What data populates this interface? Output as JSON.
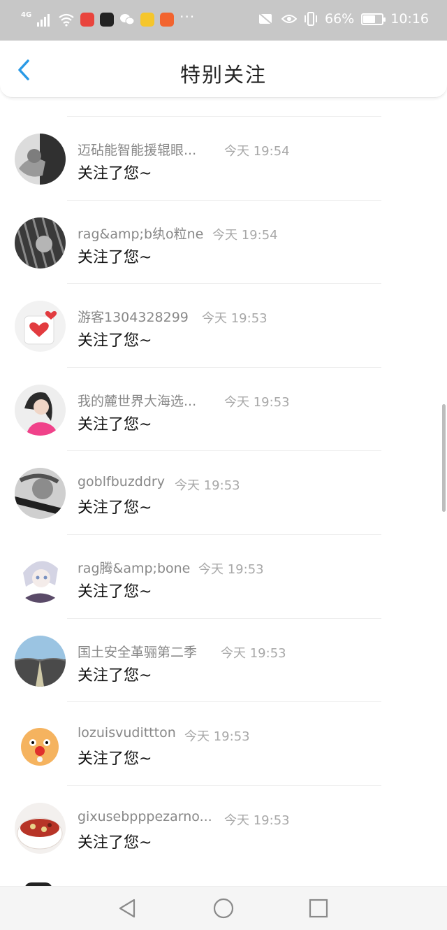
{
  "status_bar": {
    "network": "4G",
    "battery_text": "66%",
    "battery_level": 0.66,
    "time": "10:16",
    "dots": "···",
    "icons": [
      "signal-icon",
      "wifi-icon",
      "app-icon-red",
      "app-icon-black",
      "wechat-icon",
      "qq-icon",
      "app-icon-orange",
      "mute-icon",
      "eye-icon",
      "vibrate-icon",
      "battery-icon"
    ]
  },
  "header": {
    "title": "特别关注",
    "back_icon": "back-chevron-icon",
    "accent_color": "#2a9ae6"
  },
  "items": [
    {
      "name": "迈砧能智能援辊眼...",
      "time": "今天 19:54",
      "message": "关注了您~"
    },
    {
      "name": "rag&amp;b纨o粒ne",
      "time": "今天 19:54",
      "message": "关注了您~"
    },
    {
      "name": "游客1304328299",
      "time": "今天 19:53",
      "message": "关注了您~"
    },
    {
      "name": "我的麓世界大海选...",
      "time": "今天 19:53",
      "message": "关注了您~"
    },
    {
      "name": "goblfbuzddry",
      "time": "今天 19:53",
      "message": "关注了您~"
    },
    {
      "name": "rag腾&amp;bone",
      "time": "今天 19:53",
      "message": "关注了您~"
    },
    {
      "name": "国土安全革骊第二季",
      "time": "今天 19:53",
      "message": "关注了您~"
    },
    {
      "name": "lozuisvudittton",
      "time": "今天 19:53",
      "message": "关注了您~"
    },
    {
      "name": "gixusebpppezarno...",
      "time": "今天 19:53",
      "message": "关注了您~"
    }
  ],
  "navbar": {
    "back_icon": "nav-back-triangle-icon",
    "home_icon": "nav-home-circle-icon",
    "recents_icon": "nav-recents-square-icon"
  }
}
